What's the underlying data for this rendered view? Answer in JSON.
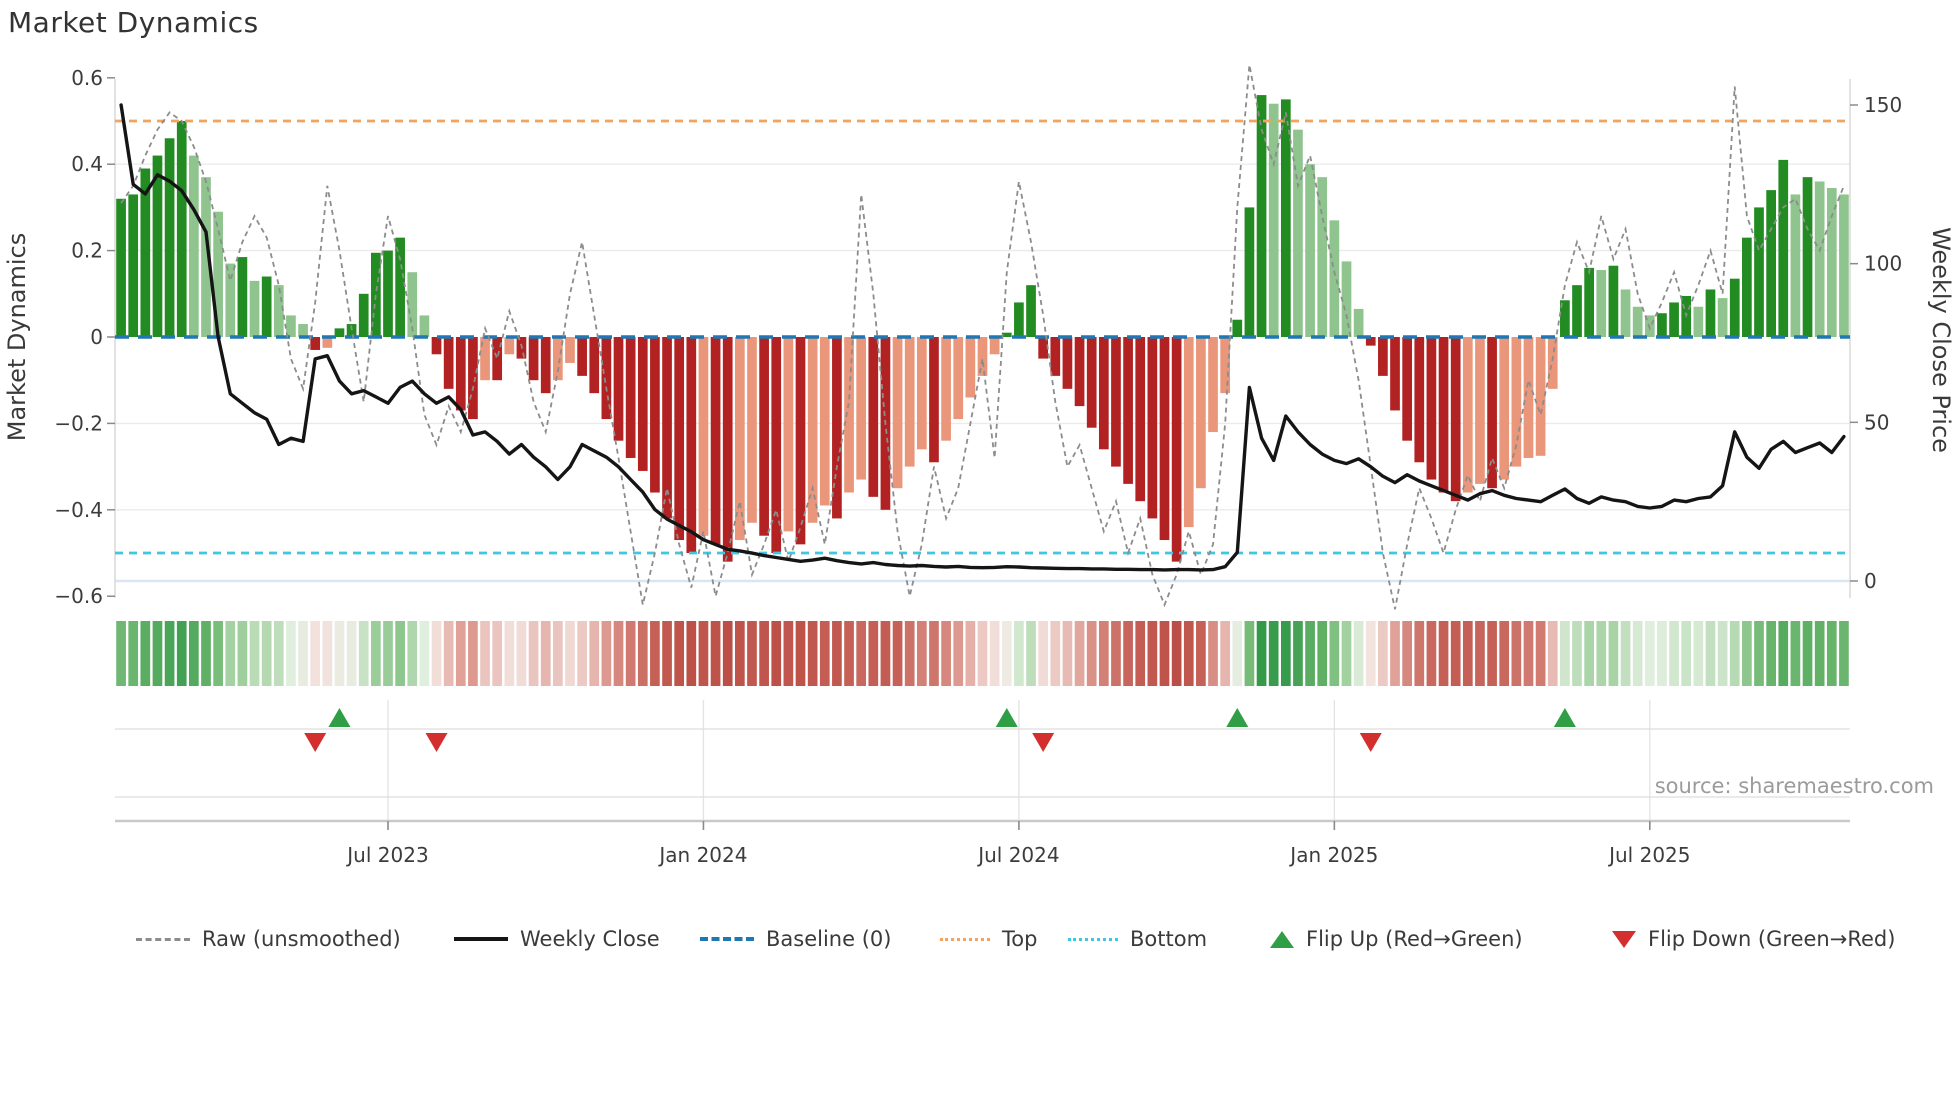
{
  "title": "Market Dynamics",
  "source": "source: sharemaestro.com",
  "axes": {
    "left": {
      "label": "Market Dynamics",
      "ticks": [
        "0.6",
        "0.4",
        "0.2",
        "0",
        "−0.2",
        "−0.4",
        "−0.6"
      ],
      "tick_values": [
        0.6,
        0.4,
        0.2,
        0,
        -0.2,
        -0.4,
        -0.6
      ],
      "range": [
        -0.6,
        0.6
      ]
    },
    "right": {
      "label": "Weekly Close Price",
      "ticks": [
        "150",
        "100",
        "50",
        "0"
      ],
      "tick_values": [
        150,
        100,
        50,
        0
      ],
      "range": [
        0,
        150
      ]
    },
    "x": {
      "ticks": [
        "Jul 2023",
        "Jan 2024",
        "Jul 2024",
        "Jan 2025",
        "Jul 2025"
      ],
      "tick_weeks": [
        22,
        48,
        74,
        100,
        126
      ]
    }
  },
  "legend": {
    "items": [
      {
        "label": "Raw (unsmoothed)",
        "type": "dashed-gray-line"
      },
      {
        "label": "Weekly Close",
        "type": "solid-black-line"
      },
      {
        "label": "Baseline (0)",
        "type": "dashed-blue-line"
      },
      {
        "label": "Top",
        "type": "dotted-orange-line"
      },
      {
        "label": "Bottom",
        "type": "dotted-cyan-line"
      },
      {
        "label": "Flip Up (Red→Green)",
        "type": "green-up-triangle"
      },
      {
        "label": "Flip Down (Green→Red)",
        "type": "red-down-triangle"
      }
    ]
  },
  "colors": {
    "bar_pos_dark": "#228B22",
    "bar_pos_light": "#8fc48f",
    "bar_neg_dark": "#B22222",
    "bar_neg_light": "#E9967A",
    "baseline": "#1f77b4",
    "top_line": "#f2a35e",
    "bottom_line": "#3fc6e0",
    "raw_line": "#8c8c8c",
    "close_line": "#151515",
    "flip_up": "#2f9e44",
    "flip_down": "#d32f2f",
    "grid": "#ebebeb",
    "price_zero_line": "#d9e6f2",
    "spine": "#c9c9c9"
  },
  "chart_data": {
    "type": "composite: bar + line + heatmap",
    "x_unit": "weeks (Feb 2023 – Oct 2025)",
    "n_weeks": 143,
    "left_ylim": [
      -0.6,
      0.6
    ],
    "right_ylim": [
      0,
      150
    ],
    "reference_lines": {
      "baseline": 0,
      "top": 0.5,
      "bottom": -0.5
    },
    "flip_up_weeks": [
      18,
      73,
      92,
      119
    ],
    "flip_down_weeks": [
      16,
      26,
      76,
      103
    ],
    "series": [
      {
        "name": "Market Dynamics (smoothed)",
        "type": "bar",
        "axis": "left",
        "values": [
          0.32,
          0.33,
          0.39,
          0.42,
          0.46,
          0.5,
          0.42,
          0.37,
          0.29,
          0.17,
          0.185,
          0.13,
          0.14,
          0.12,
          0.05,
          0.03,
          -0.03,
          -0.025,
          0.02,
          0.03,
          0.1,
          0.195,
          0.2,
          0.23,
          0.15,
          0.05,
          -0.04,
          -0.12,
          -0.17,
          -0.19,
          -0.1,
          -0.1,
          -0.04,
          -0.05,
          -0.1,
          -0.13,
          -0.1,
          -0.06,
          -0.09,
          -0.13,
          -0.19,
          -0.24,
          -0.28,
          -0.31,
          -0.36,
          -0.42,
          -0.47,
          -0.5,
          -0.46,
          -0.48,
          -0.52,
          -0.47,
          -0.43,
          -0.46,
          -0.5,
          -0.45,
          -0.48,
          -0.43,
          -0.39,
          -0.42,
          -0.36,
          -0.33,
          -0.37,
          -0.4,
          -0.35,
          -0.3,
          -0.26,
          -0.29,
          -0.24,
          -0.19,
          -0.14,
          -0.09,
          -0.04,
          0.01,
          0.08,
          0.12,
          -0.05,
          -0.09,
          -0.12,
          -0.16,
          -0.21,
          -0.26,
          -0.3,
          -0.34,
          -0.38,
          -0.42,
          -0.47,
          -0.52,
          -0.44,
          -0.35,
          -0.22,
          -0.13,
          0.04,
          0.3,
          0.56,
          0.54,
          0.55,
          0.48,
          0.4,
          0.37,
          0.27,
          0.175,
          0.065,
          -0.02,
          -0.09,
          -0.17,
          -0.24,
          -0.29,
          -0.33,
          -0.36,
          -0.38,
          -0.36,
          -0.34,
          -0.35,
          -0.33,
          -0.3,
          -0.28,
          -0.275,
          -0.12,
          0.085,
          0.12,
          0.16,
          0.155,
          0.165,
          0.11,
          0.07,
          0.05,
          0.055,
          0.08,
          0.095,
          0.07,
          0.11,
          0.09,
          0.135,
          0.23,
          0.3,
          0.34,
          0.41,
          0.33,
          0.37,
          0.36,
          0.345,
          0.33
        ]
      },
      {
        "name": "Raw (unsmoothed)",
        "type": "line",
        "style": "dashed",
        "axis": "left",
        "values": [
          0.31,
          0.35,
          0.42,
          0.48,
          0.52,
          0.5,
          0.44,
          0.36,
          0.25,
          0.13,
          0.22,
          0.28,
          0.23,
          0.12,
          -0.05,
          -0.12,
          0.08,
          0.35,
          0.2,
          0.02,
          -0.15,
          0.1,
          0.28,
          0.18,
          0.02,
          -0.18,
          -0.25,
          -0.16,
          -0.22,
          -0.12,
          0.02,
          -0.05,
          0.06,
          -0.02,
          -0.15,
          -0.22,
          -0.08,
          0.1,
          0.22,
          0.05,
          -0.12,
          -0.28,
          -0.45,
          -0.62,
          -0.5,
          -0.35,
          -0.48,
          -0.58,
          -0.45,
          -0.6,
          -0.5,
          -0.38,
          -0.55,
          -0.48,
          -0.4,
          -0.52,
          -0.44,
          -0.35,
          -0.48,
          -0.3,
          -0.15,
          0.33,
          0.1,
          -0.2,
          -0.45,
          -0.6,
          -0.48,
          -0.3,
          -0.42,
          -0.35,
          -0.2,
          -0.05,
          -0.28,
          0.15,
          0.36,
          0.22,
          0.05,
          -0.15,
          -0.3,
          -0.25,
          -0.35,
          -0.45,
          -0.38,
          -0.5,
          -0.42,
          -0.55,
          -0.62,
          -0.55,
          -0.45,
          -0.55,
          -0.48,
          -0.2,
          0.3,
          0.63,
          0.48,
          0.4,
          0.52,
          0.35,
          0.42,
          0.28,
          0.15,
          0.05,
          -0.1,
          -0.3,
          -0.5,
          -0.63,
          -0.48,
          -0.35,
          -0.42,
          -0.5,
          -0.4,
          -0.32,
          -0.38,
          -0.28,
          -0.35,
          -0.25,
          -0.1,
          -0.18,
          -0.05,
          0.12,
          0.22,
          0.15,
          0.28,
          0.18,
          0.25,
          0.1,
          0.02,
          0.08,
          0.15,
          0.05,
          0.12,
          0.2,
          0.1,
          0.58,
          0.28,
          0.2,
          0.25,
          0.3,
          0.32,
          0.25,
          0.2,
          0.28,
          0.35
        ]
      },
      {
        "name": "Weekly Close",
        "type": "line",
        "style": "solid",
        "axis": "right",
        "values": [
          150,
          125,
          122,
          128,
          126,
          123,
          117,
          110,
          77,
          59,
          56,
          53,
          51,
          43,
          45,
          44,
          70,
          71,
          63,
          59,
          60,
          58,
          56,
          61,
          63,
          59,
          56,
          58,
          54,
          46,
          47,
          44,
          40,
          43,
          39,
          36,
          32,
          36,
          43,
          41,
          39,
          36,
          32,
          28,
          22.5,
          19.5,
          17.5,
          15.5,
          13,
          11.5,
          10,
          9.5,
          8.8,
          8,
          7.4,
          6.8,
          6.2,
          6.6,
          7.2,
          6.4,
          5.8,
          5.4,
          5.8,
          5.2,
          4.9,
          4.7,
          4.9,
          4.6,
          4.4,
          4.6,
          4.3,
          4.2,
          4.3,
          4.5,
          4.4,
          4.2,
          4.1,
          4,
          3.9,
          3.9,
          3.8,
          3.8,
          3.7,
          3.7,
          3.6,
          3.6,
          3.5,
          3.6,
          3.6,
          3.5,
          3.6,
          4.5,
          9,
          61,
          45,
          38,
          52,
          47,
          43,
          40,
          38,
          37,
          38.5,
          36,
          33,
          31,
          33.5,
          31.5,
          30,
          28.5,
          27,
          25.5,
          27.5,
          28.5,
          27,
          26,
          25.5,
          25,
          27,
          29,
          26,
          24.5,
          26.5,
          25.5,
          25,
          23.5,
          23,
          23.5,
          25.5,
          25,
          26,
          26.5,
          30,
          47,
          39,
          35.5,
          41.5,
          44,
          40.5,
          42,
          43.5,
          40.5,
          45.5
        ]
      }
    ],
    "heatmap": "one cell per week, color-mapped from smoothed values (green positive / red negative)"
  }
}
